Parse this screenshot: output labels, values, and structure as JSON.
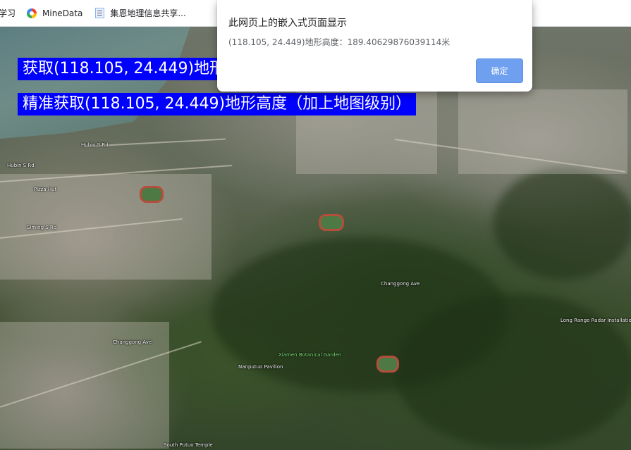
{
  "bookmarks": {
    "items": [
      {
        "label": "学习",
        "icon": "none"
      },
      {
        "label": "MineData",
        "icon": "minedata-icon"
      },
      {
        "label": "集恩地理信息共享...",
        "icon": "document-icon"
      }
    ]
  },
  "buttons": {
    "get_height": "获取(118.105, 24.449)地形高度",
    "get_height_precise": "精准获取(118.105, 24.449)地形高度（加上地图级别）"
  },
  "dialog": {
    "title": "此网页上的嵌入式页面显示",
    "message": "(118.105, 24.449)地形高度：189.40629876039114米",
    "ok_label": "确定"
  },
  "map": {
    "labels": [
      "Hubin S Rd",
      "Hubin S Rd",
      "Pizza Hut",
      "Siming S Rd",
      "Changgong Ave",
      "Changgong Ave",
      "Xiamen Botanical Garden",
      "Nanputuo Pavilion",
      "South Putuo Temple",
      "Long Range Radar Installation"
    ]
  }
}
